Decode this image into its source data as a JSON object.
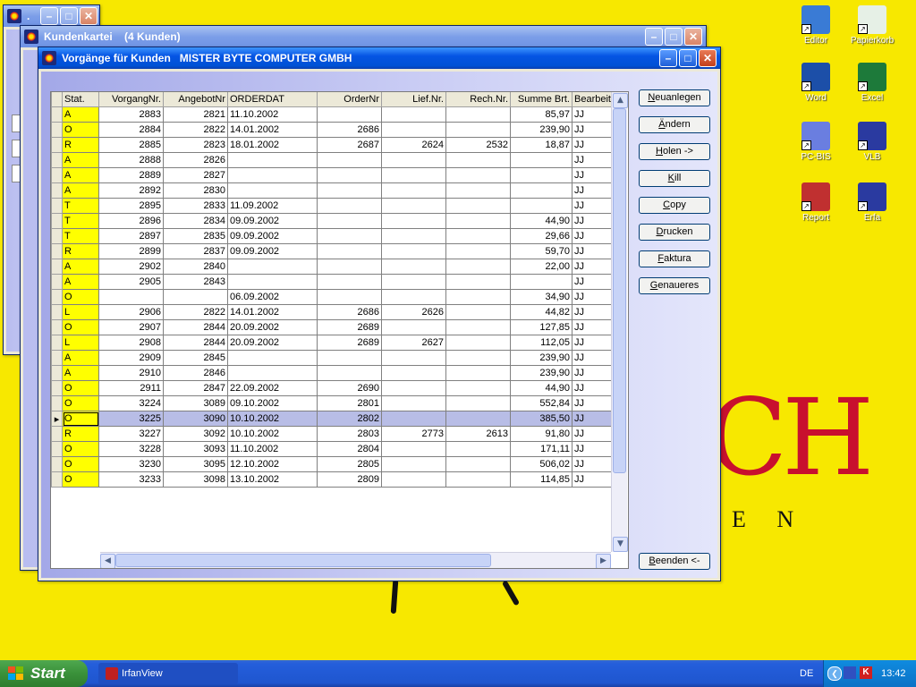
{
  "desktop": {
    "wallpaper_text": "CH",
    "wallpaper_sub": "E N",
    "icons": [
      {
        "label": "Editor",
        "icon": "editor-icon",
        "color": "#3a7bd5"
      },
      {
        "label": "Papierkorb",
        "icon": "recycle-bin-icon",
        "color": "#e6f0e6"
      },
      {
        "label": "Word",
        "icon": "word-icon",
        "color": "#1c4fa8"
      },
      {
        "label": "Excel",
        "icon": "excel-icon",
        "color": "#1d7a3a"
      },
      {
        "label": "PC-BIS",
        "icon": "pcbis-icon",
        "color": "#6a7ee0"
      },
      {
        "label": "VLB",
        "icon": "vlb-icon",
        "color": "#2a3aa0"
      },
      {
        "label": "Report",
        "icon": "report-icon",
        "color": "#c03030"
      },
      {
        "label": "Erfa",
        "icon": "erfa-icon",
        "color": "#2a3aa0"
      }
    ]
  },
  "windows": {
    "back": {
      "title": ".",
      "icon": "app-icon"
    },
    "middle": {
      "title": "Kundenkartei    (4 Kunden)"
    },
    "main": {
      "title": "Vorgänge für Kunden   MISTER BYTE COMPUTER GMBH"
    }
  },
  "grid": {
    "columns": [
      "Stat.",
      "VorgangNr.",
      "AngebotNr",
      "ORDERDAT",
      "OrderNr",
      "Lief.Nr.",
      "Rech.Nr.",
      "Summe Brt.",
      "Bearbeit"
    ],
    "rows": [
      [
        "A",
        "2883",
        "2821",
        "11.10.2002",
        "",
        "",
        "",
        "85,97",
        "JJ"
      ],
      [
        "O",
        "2884",
        "2822",
        "14.01.2002",
        "2686",
        "",
        "",
        "239,90",
        "JJ"
      ],
      [
        "R",
        "2885",
        "2823",
        "18.01.2002",
        "2687",
        "2624",
        "2532",
        "18,87",
        "JJ"
      ],
      [
        "A",
        "2888",
        "2826",
        "",
        "",
        "",
        "",
        "",
        "JJ"
      ],
      [
        "A",
        "2889",
        "2827",
        "",
        "",
        "",
        "",
        "",
        "JJ"
      ],
      [
        "A",
        "2892",
        "2830",
        "",
        "",
        "",
        "",
        "",
        "JJ"
      ],
      [
        "T",
        "2895",
        "2833",
        "11.09.2002",
        "",
        "",
        "",
        "",
        "JJ"
      ],
      [
        "T",
        "2896",
        "2834",
        "09.09.2002",
        "",
        "",
        "",
        "44,90",
        "JJ"
      ],
      [
        "T",
        "2897",
        "2835",
        "09.09.2002",
        "",
        "",
        "",
        "29,66",
        "JJ"
      ],
      [
        "R",
        "2899",
        "2837",
        "09.09.2002",
        "",
        "",
        "",
        "59,70",
        "JJ"
      ],
      [
        "A",
        "2902",
        "2840",
        "",
        "",
        "",
        "",
        "22,00",
        "JJ"
      ],
      [
        "A",
        "2905",
        "2843",
        "",
        "",
        "",
        "",
        "",
        "JJ"
      ],
      [
        "O",
        "",
        "",
        "06.09.2002",
        "",
        "",
        "",
        "34,90",
        "JJ"
      ],
      [
        "L",
        "2906",
        "2822",
        "14.01.2002",
        "2686",
        "2626",
        "",
        "44,82",
        "JJ"
      ],
      [
        "O",
        "2907",
        "2844",
        "20.09.2002",
        "2689",
        "",
        "",
        "127,85",
        "JJ"
      ],
      [
        "L",
        "2908",
        "2844",
        "20.09.2002",
        "2689",
        "2627",
        "",
        "112,05",
        "JJ"
      ],
      [
        "A",
        "2909",
        "2845",
        "",
        "",
        "",
        "",
        "239,90",
        "JJ"
      ],
      [
        "A",
        "2910",
        "2846",
        "",
        "",
        "",
        "",
        "239,90",
        "JJ"
      ],
      [
        "O",
        "2911",
        "2847",
        "22.09.2002",
        "2690",
        "",
        "",
        "44,90",
        "JJ"
      ],
      [
        "O",
        "3224",
        "3089",
        "09.10.2002",
        "2801",
        "",
        "",
        "552,84",
        "JJ"
      ],
      [
        "O",
        "3225",
        "3090",
        "10.10.2002",
        "2802",
        "",
        "",
        "385,50",
        "JJ"
      ],
      [
        "R",
        "3227",
        "3092",
        "10.10.2002",
        "2803",
        "2773",
        "2613",
        "91,80",
        "JJ"
      ],
      [
        "O",
        "3228",
        "3093",
        "11.10.2002",
        "2804",
        "",
        "",
        "171,11",
        "JJ"
      ],
      [
        "O",
        "3230",
        "3095",
        "12.10.2002",
        "2805",
        "",
        "",
        "506,02",
        "JJ"
      ],
      [
        "O",
        "3233",
        "3098",
        "13.10.2002",
        "2809",
        "",
        "",
        "114,85",
        "JJ"
      ]
    ],
    "selected_row": 20
  },
  "buttons": {
    "neuanlegen": "Neuanlegen",
    "aendern": "Ändern",
    "holen": "Holen ->",
    "kill": "Kill",
    "copy": "Copy",
    "drucken": "Drucken",
    "faktura": "Faktura",
    "genaueres": "Genaueres",
    "beenden": "Beenden <-"
  },
  "taskbar": {
    "start": "Start",
    "task": "IrfanView",
    "lang": "DE",
    "clock": "13:42"
  },
  "colors": {
    "status_cell": "#ffff00",
    "selected_row": "#b8bde6",
    "wallpaper": "#f7e800",
    "accent": "#c8102e"
  }
}
